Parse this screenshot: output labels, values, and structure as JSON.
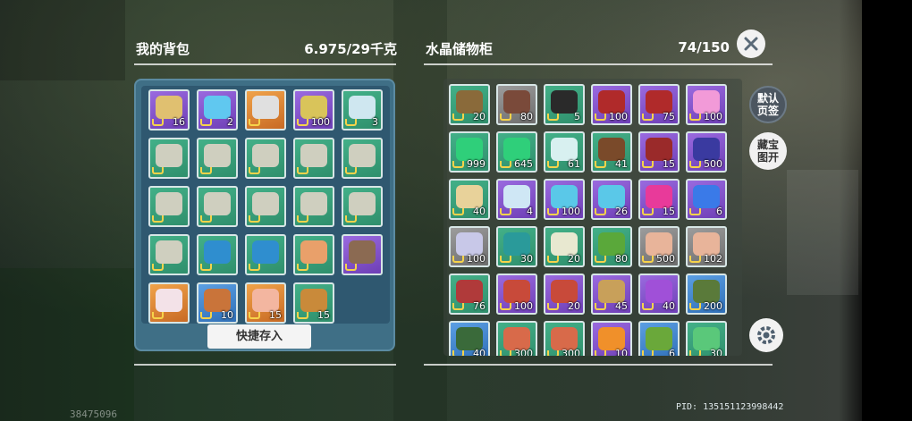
{
  "backpack": {
    "title": "我的背包",
    "weight": "6.975/29千克",
    "quick_store_label": "快捷存入",
    "slots": [
      {
        "color": "purple",
        "icon": "#e0c070",
        "count": "16"
      },
      {
        "color": "purple",
        "icon": "#60c8f0",
        "count": "2"
      },
      {
        "color": "orange",
        "icon": "#e0e0e0",
        "count": ""
      },
      {
        "color": "purple",
        "icon": "#d9c45a",
        "count": "100"
      },
      {
        "color": "green",
        "icon": "#cfe7f0",
        "count": "3"
      },
      {
        "color": "green",
        "icon": "#cfcfbf",
        "count": ""
      },
      {
        "color": "green",
        "icon": "#cfcfbf",
        "count": ""
      },
      {
        "color": "green",
        "icon": "#cfcfbf",
        "count": ""
      },
      {
        "color": "green",
        "icon": "#cfcfbf",
        "count": ""
      },
      {
        "color": "green",
        "icon": "#cfcfbf",
        "count": ""
      },
      {
        "color": "green",
        "icon": "#cfcfbf",
        "count": ""
      },
      {
        "color": "green",
        "icon": "#cfcfbf",
        "count": ""
      },
      {
        "color": "green",
        "icon": "#cfcfbf",
        "count": ""
      },
      {
        "color": "green",
        "icon": "#cfcfbf",
        "count": ""
      },
      {
        "color": "green",
        "icon": "#cfcfbf",
        "count": ""
      },
      {
        "color": "green",
        "icon": "#cfcfbf",
        "count": ""
      },
      {
        "color": "green",
        "icon": "#2f8ecf",
        "count": ""
      },
      {
        "color": "green",
        "icon": "#2f8ecf",
        "count": ""
      },
      {
        "color": "green",
        "icon": "#e9a06a",
        "count": ""
      },
      {
        "color": "purple",
        "icon": "#8b6a52",
        "count": ""
      },
      {
        "color": "orange",
        "icon": "#f3e2e8",
        "count": ""
      },
      {
        "color": "blue",
        "icon": "#c9743a",
        "count": "10"
      },
      {
        "color": "orange",
        "icon": "#f3b6a0",
        "count": "15"
      },
      {
        "color": "green",
        "icon": "#c98a3a",
        "count": "15"
      }
    ]
  },
  "storage": {
    "title": "水晶储物柜",
    "capacity": "74/150",
    "slots": [
      {
        "color": "green",
        "icon": "#8a6a3a",
        "count": "20"
      },
      {
        "color": "gray",
        "icon": "#7a4a3a",
        "count": "80"
      },
      {
        "color": "green",
        "icon": "#2a2a2a",
        "count": "5"
      },
      {
        "color": "purple",
        "icon": "#b02a2a",
        "count": "100"
      },
      {
        "color": "purple",
        "icon": "#b02a2a",
        "count": "75"
      },
      {
        "color": "purple",
        "icon": "#f29ad8",
        "count": "100"
      },
      {
        "color": "green",
        "icon": "#2fcf7a",
        "count": "999"
      },
      {
        "color": "green",
        "icon": "#2fcf7a",
        "count": "645"
      },
      {
        "color": "green",
        "icon": "#d8f0f0",
        "count": "61"
      },
      {
        "color": "green",
        "icon": "#7a4a2a",
        "count": "41"
      },
      {
        "color": "purple",
        "icon": "#9a2a2a",
        "count": "15"
      },
      {
        "color": "purple",
        "icon": "#3a3aa0",
        "count": "500"
      },
      {
        "color": "green",
        "icon": "#e8d29a",
        "count": "40"
      },
      {
        "color": "purple",
        "icon": "#cfe7f5",
        "count": "4"
      },
      {
        "color": "purple",
        "icon": "#5ac8e8",
        "count": "100"
      },
      {
        "color": "purple",
        "icon": "#5ac8e8",
        "count": "26"
      },
      {
        "color": "purple",
        "icon": "#e83a9a",
        "count": "15"
      },
      {
        "color": "purple",
        "icon": "#3a7ae8",
        "count": "6"
      },
      {
        "color": "gray",
        "icon": "#c8c8e8",
        "count": "100"
      },
      {
        "color": "green",
        "icon": "#2a9a9a",
        "count": "30"
      },
      {
        "color": "green",
        "icon": "#e8e8d0",
        "count": "20"
      },
      {
        "color": "green",
        "icon": "#5aa83a",
        "count": "80"
      },
      {
        "color": "gray",
        "icon": "#e8b49a",
        "count": "500"
      },
      {
        "color": "gray",
        "icon": "#e8b49a",
        "count": "102"
      },
      {
        "color": "green",
        "icon": "#b03a3a",
        "count": "76"
      },
      {
        "color": "purple",
        "icon": "#c84a3a",
        "count": "100"
      },
      {
        "color": "purple",
        "icon": "#c84a3a",
        "count": "20"
      },
      {
        "color": "purple",
        "icon": "#c8a05a",
        "count": "45"
      },
      {
        "color": "purple",
        "icon": "#a050d8",
        "count": "40"
      },
      {
        "color": "blue",
        "icon": "#5a7a3a",
        "count": "200"
      },
      {
        "color": "blue",
        "icon": "#3a6a3a",
        "count": "40"
      },
      {
        "color": "green",
        "icon": "#d86a4a",
        "count": "300"
      },
      {
        "color": "green",
        "icon": "#d86a4a",
        "count": "300"
      },
      {
        "color": "purple",
        "icon": "#f0902a",
        "count": "10"
      },
      {
        "color": "blue",
        "icon": "#6aa83a",
        "count": "6"
      },
      {
        "color": "green",
        "icon": "#5ac87a",
        "count": "30"
      }
    ]
  },
  "side_buttons": {
    "default_tab": "默认\n页签",
    "treasure_map": "藏宝\n图开"
  },
  "pid_text": "PID: 135151123998442",
  "uid_text": "38475096",
  "colors": {
    "panel": "#3f6f86",
    "slot_green": "#43b088",
    "slot_purple": "#9a6adf"
  }
}
